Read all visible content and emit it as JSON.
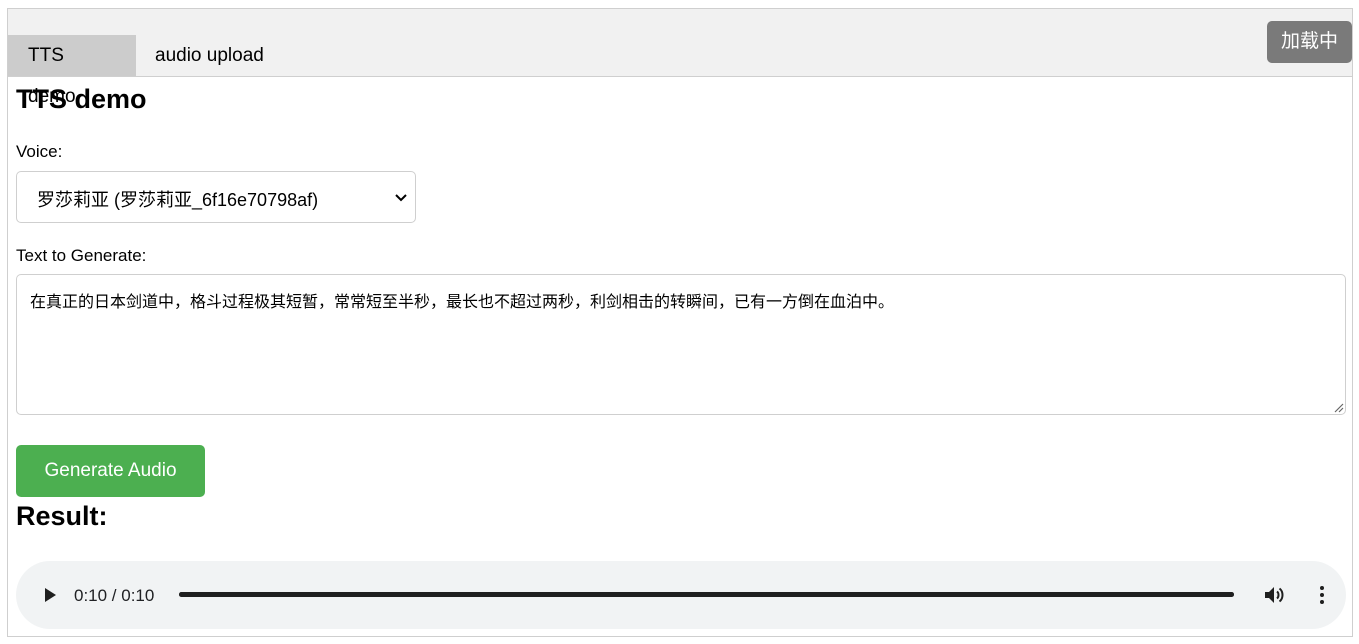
{
  "tabs": [
    {
      "label": "TTS demo",
      "active": true
    },
    {
      "label": "audio upload",
      "active": false
    }
  ],
  "loading_badge": "加载中",
  "page_title": "TTS demo",
  "voice": {
    "label": "Voice:",
    "selected": "罗莎莉亚 (罗莎莉亚_6f16e70798af)"
  },
  "text_field": {
    "label": "Text to Generate:",
    "value": "在真正的日本剑道中，格斗过程极其短暂，常常短至半秒，最长也不超过两秒，利剑相击的转瞬间，已有一方倒在血泊中。"
  },
  "generate_button": "Generate Audio",
  "result_title": "Result:",
  "audio": {
    "time_text": "0:10 / 0:10",
    "progress": 1.0
  },
  "colors": {
    "accent_green": "#4caf50",
    "badge_gray": "#7a7a7a",
    "active_tab": "#cccccc",
    "tabbar_bg": "#f1f1f1",
    "player_bg": "#f1f3f4"
  }
}
